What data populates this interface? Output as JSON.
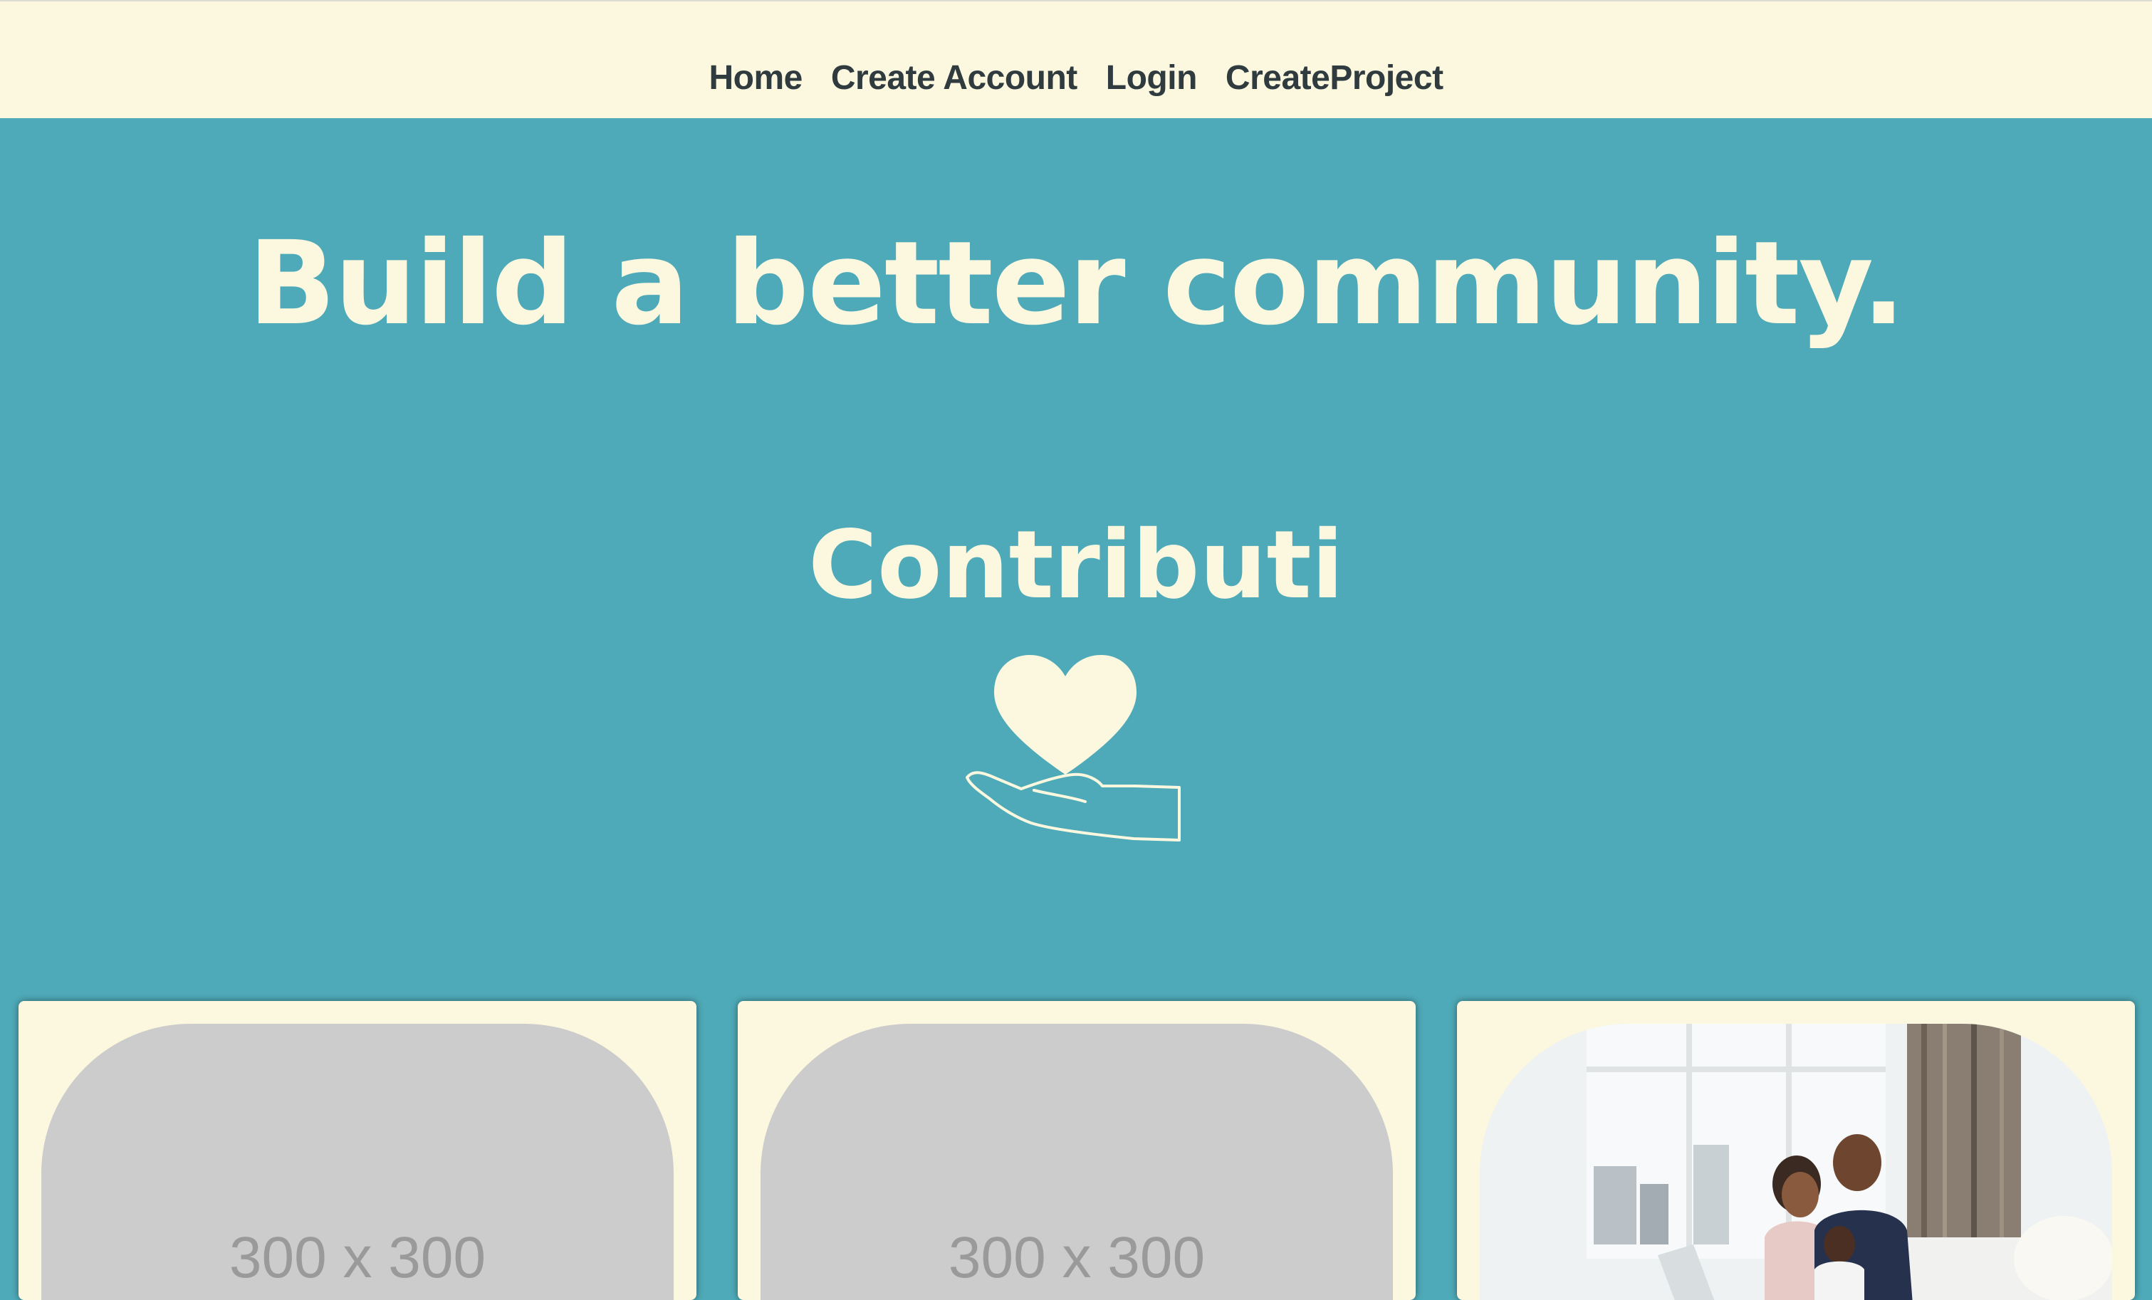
{
  "nav": {
    "items": [
      {
        "label": "Home"
      },
      {
        "label": "Create Account"
      },
      {
        "label": "Login"
      },
      {
        "label": "CreateProject"
      }
    ]
  },
  "hero": {
    "title": "Build a better community.",
    "brand": "Contributi",
    "logo_icon": "heart-in-hand-icon"
  },
  "cards": [
    {
      "image": "placeholder",
      "placeholder_text": "300 x 300"
    },
    {
      "image": "placeholder",
      "placeholder_text": "300 x 300"
    },
    {
      "image": "family-photo"
    }
  ],
  "colors": {
    "background": "#4eaab8",
    "cream": "#fcf8df",
    "nav_text": "#2f3b3e",
    "placeholder": "#cccccc"
  }
}
